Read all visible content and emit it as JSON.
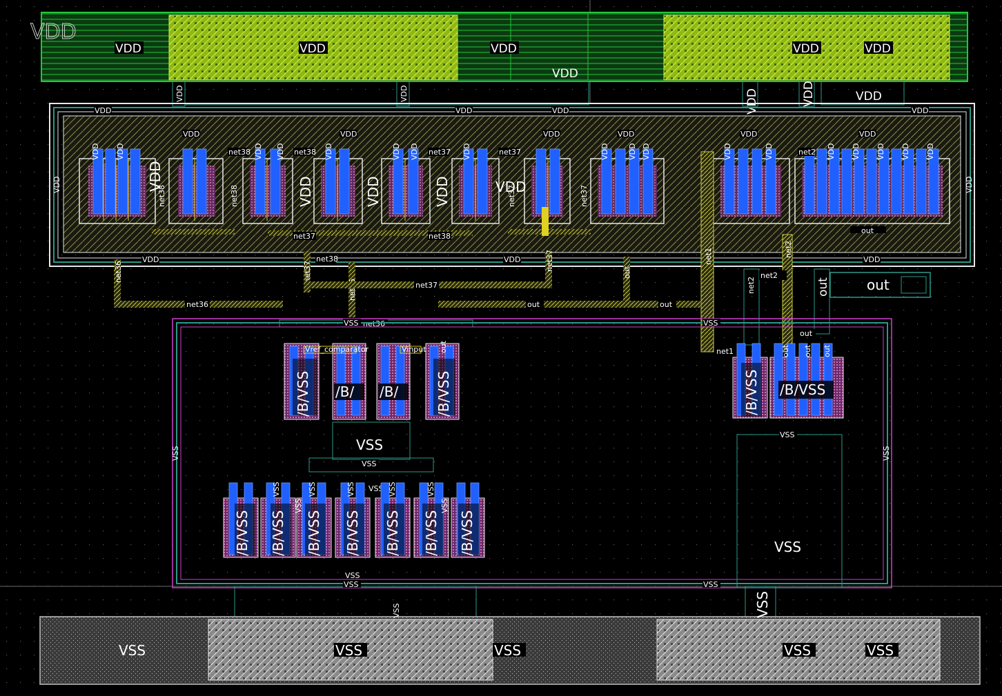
{
  "colors": {
    "background": "#000000",
    "vdd_rail": "#22c83a",
    "vdd_fill": "#b7e21a",
    "vss_rail": "#bdbdbd",
    "nwell_outline": "#e8e8e8",
    "pwell_outline": "#d040d0",
    "poly": "#e0d020",
    "metal1": "#2060ff",
    "diffusion": "#d070b0",
    "wire": "#9a9a30",
    "via": "#2a9a8a"
  },
  "rails": {
    "vdd_big": "VDD",
    "vdd_labels": [
      "VDD",
      "VDD",
      "VDD",
      "VDD",
      "VDD",
      "VDD",
      "VDD"
    ],
    "vss_big": "VSS",
    "vss_labels": [
      "VSS",
      "VSS",
      "VSS",
      "VSS",
      "VSS"
    ]
  },
  "nwell": {
    "ring_labels": [
      "VDD",
      "VDD",
      "VDD",
      "VDD",
      "VDD",
      "VDD",
      "VDD",
      "VDD"
    ],
    "pmos_labels": [
      "VDD",
      "VDD",
      "VDD",
      "VDD",
      "VDD",
      "VDD",
      "VDD",
      "VDD",
      "VDD",
      "VDD"
    ],
    "side_labels": [
      "VDD",
      "VDD"
    ],
    "nets": [
      "net38",
      "net38",
      "net38",
      "net37",
      "net37",
      "net37",
      "net38",
      "net37",
      "net1",
      "net2"
    ],
    "big_device_labels": [
      "VDD",
      "VDD",
      "VDD",
      "VDD",
      "VDD"
    ],
    "bottom_nets": [
      "net37",
      "net38",
      "out",
      "net36"
    ]
  },
  "routing": {
    "net36": "net36",
    "net37": "net37",
    "net38": "net38",
    "out": "out",
    "net1": "net1",
    "net2": "net2",
    "out_pin": "out",
    "vref_comparator": "Vref_comparator",
    "vinput": "Vinput"
  },
  "pwell": {
    "ring_labels": [
      "VSS",
      "VSS",
      "VSS",
      "VSS",
      "VSS",
      "VSS",
      "VSS"
    ],
    "devices_top": [
      "/B/VSS",
      "/B/",
      "/B/",
      "/B/VSS"
    ],
    "devices_bottom": [
      "/B/VSS",
      "/B/VSS",
      "/B/VSS",
      "/B/VSS",
      "/B/VSS",
      "/B/VSS",
      "/B/VSS"
    ],
    "devices_right": [
      "/B/VSS",
      "/B/VSS"
    ],
    "vss_mid": "VSS",
    "vss_row": [
      "VSS",
      "VSS",
      "VSS",
      "VSS",
      "VSS",
      "VSS",
      "VSS",
      "VSS"
    ],
    "vss_big_right": "VSS",
    "vss_side": [
      "VSS",
      "VSS"
    ],
    "out_labels": [
      "out",
      "out",
      "out",
      "out"
    ],
    "net1_label": "net1"
  }
}
